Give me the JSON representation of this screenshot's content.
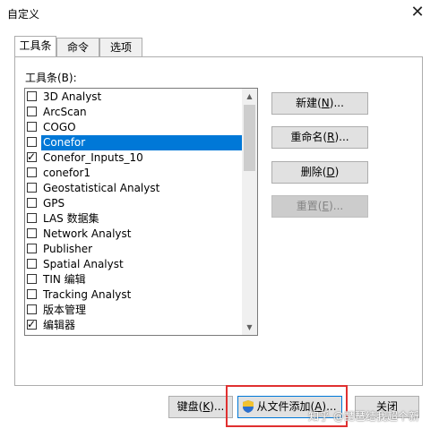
{
  "window": {
    "title": "自定义",
    "close_glyph": "✕"
  },
  "tabs": [
    {
      "label": "工具条",
      "active": true
    },
    {
      "label": "命令",
      "active": false
    },
    {
      "label": "选项",
      "active": false
    }
  ],
  "toolbars_label": "工具条(B):",
  "toolbars": [
    {
      "label": "3D Analyst",
      "checked": false,
      "selected": false
    },
    {
      "label": "ArcScan",
      "checked": false,
      "selected": false
    },
    {
      "label": "COGO",
      "checked": false,
      "selected": false
    },
    {
      "label": "Conefor",
      "checked": false,
      "selected": true
    },
    {
      "label": "Conefor_Inputs_10",
      "checked": true,
      "selected": false
    },
    {
      "label": "conefor1",
      "checked": false,
      "selected": false
    },
    {
      "label": "Geostatistical Analyst",
      "checked": false,
      "selected": false
    },
    {
      "label": "GPS",
      "checked": false,
      "selected": false
    },
    {
      "label": "LAS 数据集",
      "checked": false,
      "selected": false
    },
    {
      "label": "Network Analyst",
      "checked": false,
      "selected": false
    },
    {
      "label": "Publisher",
      "checked": false,
      "selected": false
    },
    {
      "label": "Spatial Analyst",
      "checked": false,
      "selected": false
    },
    {
      "label": "TIN 编辑",
      "checked": false,
      "selected": false
    },
    {
      "label": "Tracking Analyst",
      "checked": false,
      "selected": false
    },
    {
      "label": "版本管理",
      "checked": false,
      "selected": false
    },
    {
      "label": "编辑器",
      "checked": true,
      "selected": false
    }
  ],
  "side_buttons": {
    "new": {
      "text": "新建(",
      "key": "N",
      "suffix": ")..."
    },
    "rename": {
      "text": "重命名(",
      "key": "R",
      "suffix": ")..."
    },
    "delete": {
      "text": "删除(",
      "key": "D",
      "suffix": ")"
    },
    "reset": {
      "text": "重置(",
      "key": "E",
      "suffix": ")...",
      "disabled": true
    }
  },
  "bottom_buttons": {
    "keyboard": {
      "text": "键盘(",
      "key": "K",
      "suffix": ")..."
    },
    "add_from_file": {
      "text": "从文件添加(",
      "key": "A",
      "suffix": ")..."
    },
    "close": {
      "label": "关闭"
    }
  },
  "watermark": "知乎 @琵琶结我超个新",
  "colors": {
    "selection": "#0078d7",
    "highlight_box": "#e03030"
  }
}
